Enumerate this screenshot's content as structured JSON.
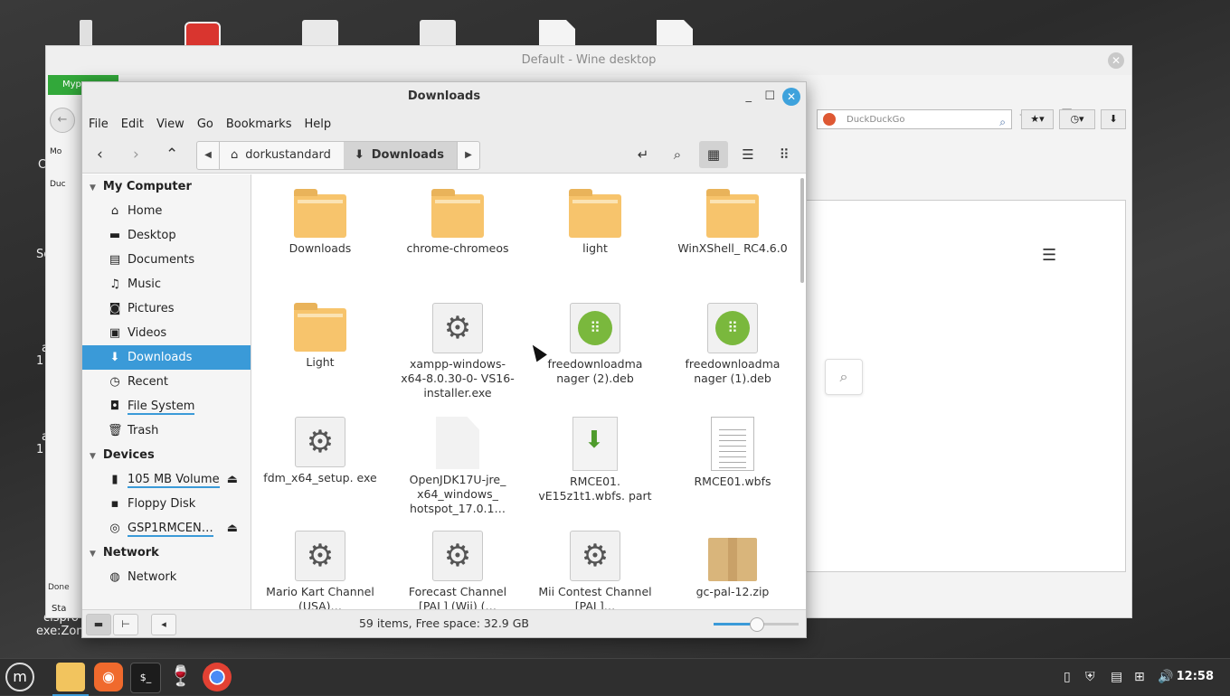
{
  "desktop": {
    "side_texts": [
      "C",
      "Sc",
      "a",
      "1",
      "a",
      "1",
      "cispro",
      "exe:Zon"
    ]
  },
  "wine": {
    "title": "Default - Wine desktop",
    "close": "✕",
    "green_tab": "Myp",
    "browser": {
      "search_placeholder": "DuckDuckGo",
      "sidebar_fragments": [
        "Mo",
        "Duc"
      ],
      "status": "Done",
      "taskbar_fragment": "Sta",
      "menu_icon": "hamburger-menu-icon",
      "search_icon": "magnifier-icon"
    }
  },
  "file_manager": {
    "title": "Downloads",
    "menu": [
      "File",
      "Edit",
      "View",
      "Go",
      "Bookmarks",
      "Help"
    ],
    "breadcrumbs": [
      {
        "label": "dorkustandard",
        "icon": "home-icon"
      },
      {
        "label": "Downloads",
        "icon": "download-icon",
        "active": true
      }
    ],
    "sidebar": {
      "sections": [
        {
          "title": "My Computer",
          "items": [
            {
              "label": "Home",
              "icon": "home-icon"
            },
            {
              "label": "Desktop",
              "icon": "desktop-icon"
            },
            {
              "label": "Documents",
              "icon": "document-icon"
            },
            {
              "label": "Music",
              "icon": "music-icon"
            },
            {
              "label": "Pictures",
              "icon": "camera-icon"
            },
            {
              "label": "Videos",
              "icon": "video-icon"
            },
            {
              "label": "Downloads",
              "icon": "download-icon",
              "selected": true
            },
            {
              "label": "Recent",
              "icon": "clock-icon"
            },
            {
              "label": "File System",
              "icon": "drive-icon",
              "underline": true
            },
            {
              "label": "Trash",
              "icon": "trash-icon"
            }
          ]
        },
        {
          "title": "Devices",
          "items": [
            {
              "label": "105 MB Volume",
              "icon": "usb-icon",
              "underline": true,
              "eject": true
            },
            {
              "label": "Floppy Disk",
              "icon": "floppy-icon"
            },
            {
              "label": "GSP1RMCEN…",
              "icon": "disc-icon",
              "underline": true,
              "eject": true
            }
          ]
        },
        {
          "title": "Network",
          "items": [
            {
              "label": "Network",
              "icon": "globe-icon"
            }
          ]
        }
      ]
    },
    "files": [
      {
        "name": "Downloads",
        "type": "folder"
      },
      {
        "name": "chrome-chromeos",
        "type": "folder"
      },
      {
        "name": "light",
        "type": "folder"
      },
      {
        "name": "WinXShell_ RC4.6.0",
        "type": "folder"
      },
      {
        "name": "Light",
        "type": "folder"
      },
      {
        "name": "xampp-windows- x64-8.0.30-0- VS16-installer.exe",
        "type": "exe"
      },
      {
        "name": "freedownloadma nager (2).deb",
        "type": "deb"
      },
      {
        "name": "freedownloadma nager (1).deb",
        "type": "deb"
      },
      {
        "name": "fdm_x64_setup. exe",
        "type": "exe"
      },
      {
        "name": "OpenJDK17U-jre_ x64_windows_ hotspot_17.0.1…",
        "type": "blank"
      },
      {
        "name": "RMCE01. vE15z1t1.wbfs. part",
        "type": "part"
      },
      {
        "name": "RMCE01.wbfs",
        "type": "text"
      },
      {
        "name": "Mario Kart Channel (USA)…",
        "type": "exe"
      },
      {
        "name": "Forecast Channel [PAL] (Wii) (…",
        "type": "exe"
      },
      {
        "name": "Mii Contest Channel [PAL]…",
        "type": "exe"
      },
      {
        "name": "gc-pal-12.zip",
        "type": "zip"
      }
    ],
    "status": "59 items, Free space: 32.9 GB",
    "zoom_level": 0.5
  },
  "taskbar": {
    "clock": "12:58",
    "apps": [
      "menu-icon",
      "files-icon",
      "firefox-icon",
      "terminal-icon",
      "wine-icon",
      "chrome-icon"
    ]
  }
}
